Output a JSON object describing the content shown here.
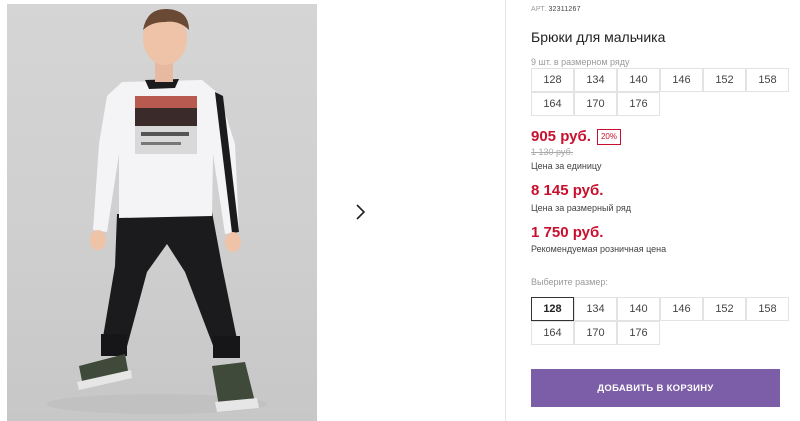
{
  "gallery": {
    "photo_alt": "model-photo",
    "next_icon": "chevron-right-icon"
  },
  "product": {
    "sku_label": "АРТ.",
    "sku_value": "32311267",
    "title": "Брюки для мальчика",
    "pack_note": "9 шт. в размерном ряду",
    "pack_sizes": [
      "128",
      "134",
      "140",
      "146",
      "152",
      "158",
      "164",
      "170",
      "176"
    ]
  },
  "pricing": {
    "unit_price": "905 руб.",
    "discount_badge": "20%",
    "old_price": "1 130 руб.",
    "unit_caption": "Цена за единицу",
    "pack_price": "8 145 руб.",
    "pack_caption": "Цена за размерный ряд",
    "retail_price": "1 750 руб.",
    "retail_caption": "Рекомендуемая розничная цена"
  },
  "size_picker": {
    "label": "Выберите размер:",
    "sizes": [
      "128",
      "134",
      "140",
      "146",
      "152",
      "158",
      "164",
      "170",
      "176"
    ],
    "selected": "128"
  },
  "actions": {
    "add_to_cart": "ДОБАВИТЬ В КОРЗИНУ"
  },
  "colors": {
    "accent": "#7b5ea7",
    "price": "#c8102e"
  }
}
